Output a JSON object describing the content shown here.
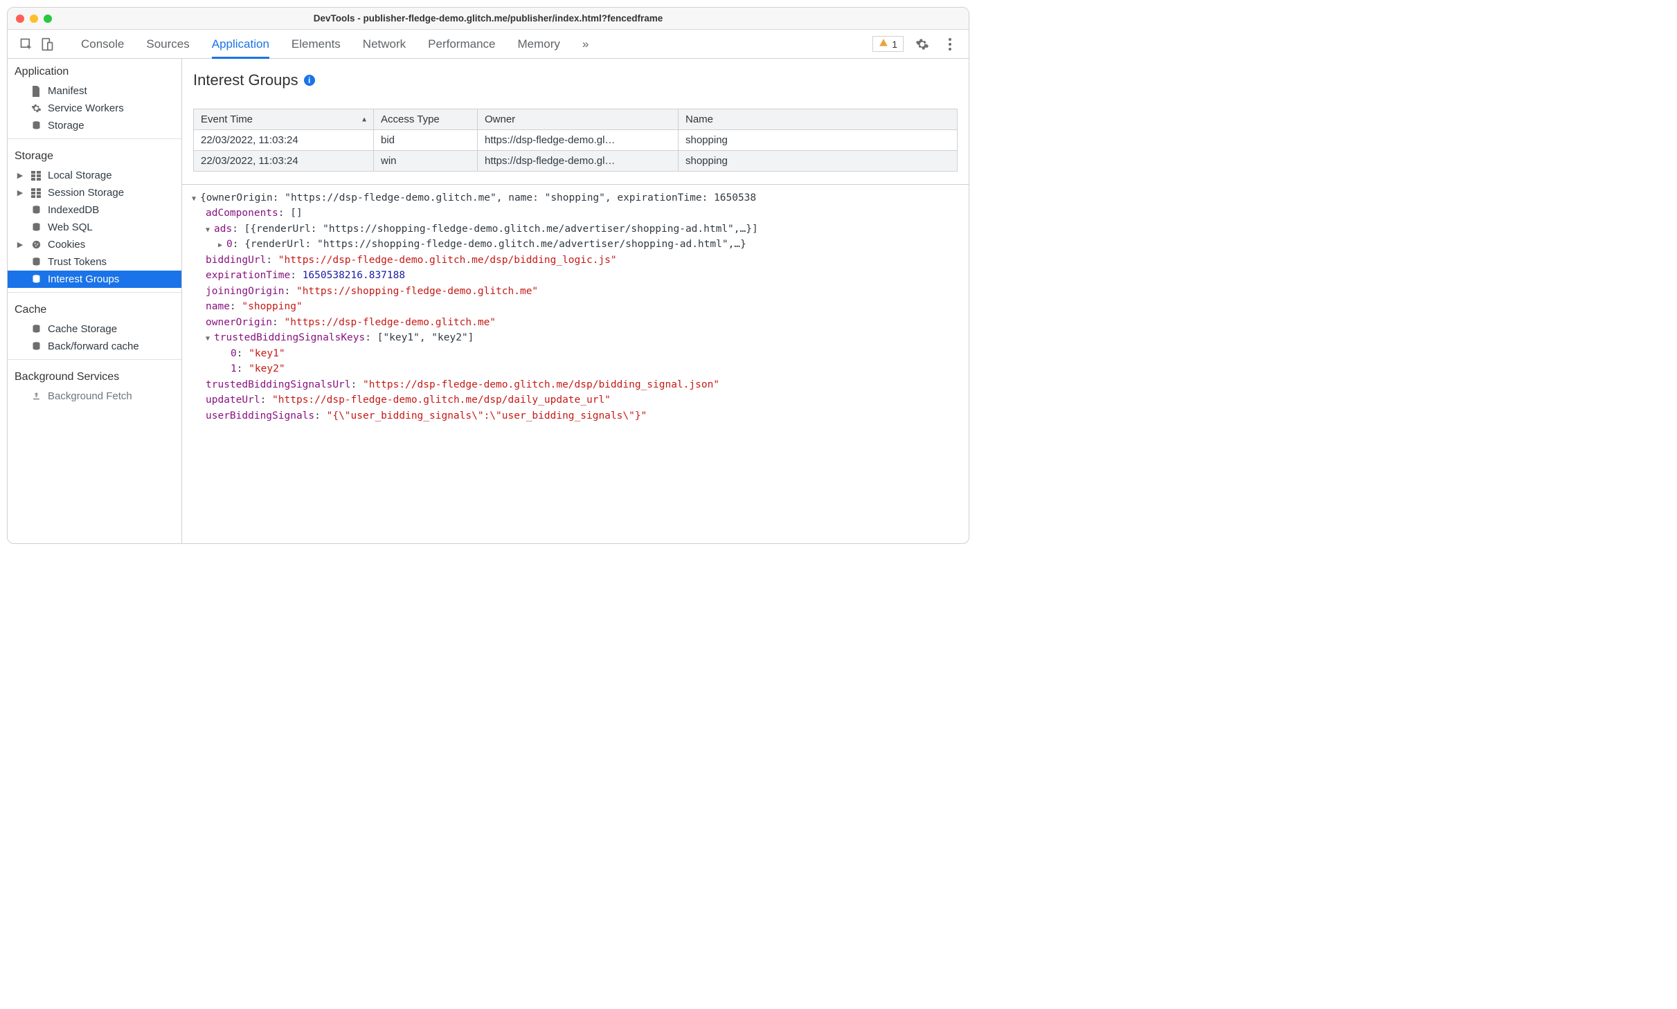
{
  "window": {
    "title": "DevTools - publisher-fledge-demo.glitch.me/publisher/index.html?fencedframe"
  },
  "toolbar": {
    "tabs": [
      "Console",
      "Sources",
      "Application",
      "Elements",
      "Network",
      "Performance",
      "Memory"
    ],
    "active_tab": "Application",
    "overflow": "»",
    "warning_count": "1"
  },
  "sidebar": {
    "groups": [
      {
        "title": "Application",
        "items": [
          {
            "label": "Manifest",
            "icon": "file"
          },
          {
            "label": "Service Workers",
            "icon": "gear"
          },
          {
            "label": "Storage",
            "icon": "database"
          }
        ]
      },
      {
        "title": "Storage",
        "items": [
          {
            "label": "Local Storage",
            "icon": "grid",
            "expandable": true
          },
          {
            "label": "Session Storage",
            "icon": "grid",
            "expandable": true
          },
          {
            "label": "IndexedDB",
            "icon": "database"
          },
          {
            "label": "Web SQL",
            "icon": "database"
          },
          {
            "label": "Cookies",
            "icon": "cookie",
            "expandable": true
          },
          {
            "label": "Trust Tokens",
            "icon": "database"
          },
          {
            "label": "Interest Groups",
            "icon": "database",
            "selected": true
          }
        ]
      },
      {
        "title": "Cache",
        "items": [
          {
            "label": "Cache Storage",
            "icon": "database"
          },
          {
            "label": "Back/forward cache",
            "icon": "database"
          }
        ]
      },
      {
        "title": "Background Services",
        "items": [
          {
            "label": "Background Fetch",
            "icon": "upload"
          }
        ]
      }
    ]
  },
  "panel": {
    "title": "Interest Groups",
    "columns": [
      "Event Time",
      "Access Type",
      "Owner",
      "Name"
    ],
    "rows": [
      {
        "time": "22/03/2022, 11:03:24",
        "type": "bid",
        "owner": "https://dsp-fledge-demo.gl…",
        "name": "shopping"
      },
      {
        "time": "22/03/2022, 11:03:24",
        "type": "win",
        "owner": "https://dsp-fledge-demo.gl…",
        "name": "shopping"
      }
    ]
  },
  "detail": {
    "header_line": "{ownerOrigin: \"https://dsp-fledge-demo.glitch.me\", name: \"shopping\", expirationTime: 1650538",
    "adComponents": "[]",
    "ads_summary": "[{renderUrl: \"https://shopping-fledge-demo.glitch.me/advertiser/shopping-ad.html\",…}]",
    "ads_0": "{renderUrl: \"https://shopping-fledge-demo.glitch.me/advertiser/shopping-ad.html\",…}",
    "biddingUrl": "\"https://dsp-fledge-demo.glitch.me/dsp/bidding_logic.js\"",
    "expirationTime": "1650538216.837188",
    "joiningOrigin": "\"https://shopping-fledge-demo.glitch.me\"",
    "name": "\"shopping\"",
    "ownerOrigin": "\"https://dsp-fledge-demo.glitch.me\"",
    "tbsk_summary": "[\"key1\", \"key2\"]",
    "tbsk_0": "\"key1\"",
    "tbsk_1": "\"key2\"",
    "trustedBiddingSignalsUrl": "\"https://dsp-fledge-demo.glitch.me/dsp/bidding_signal.json\"",
    "updateUrl": "\"https://dsp-fledge-demo.glitch.me/dsp/daily_update_url\"",
    "userBiddingSignals": "\"{\\\"user_bidding_signals\\\":\\\"user_bidding_signals\\\"}\""
  }
}
